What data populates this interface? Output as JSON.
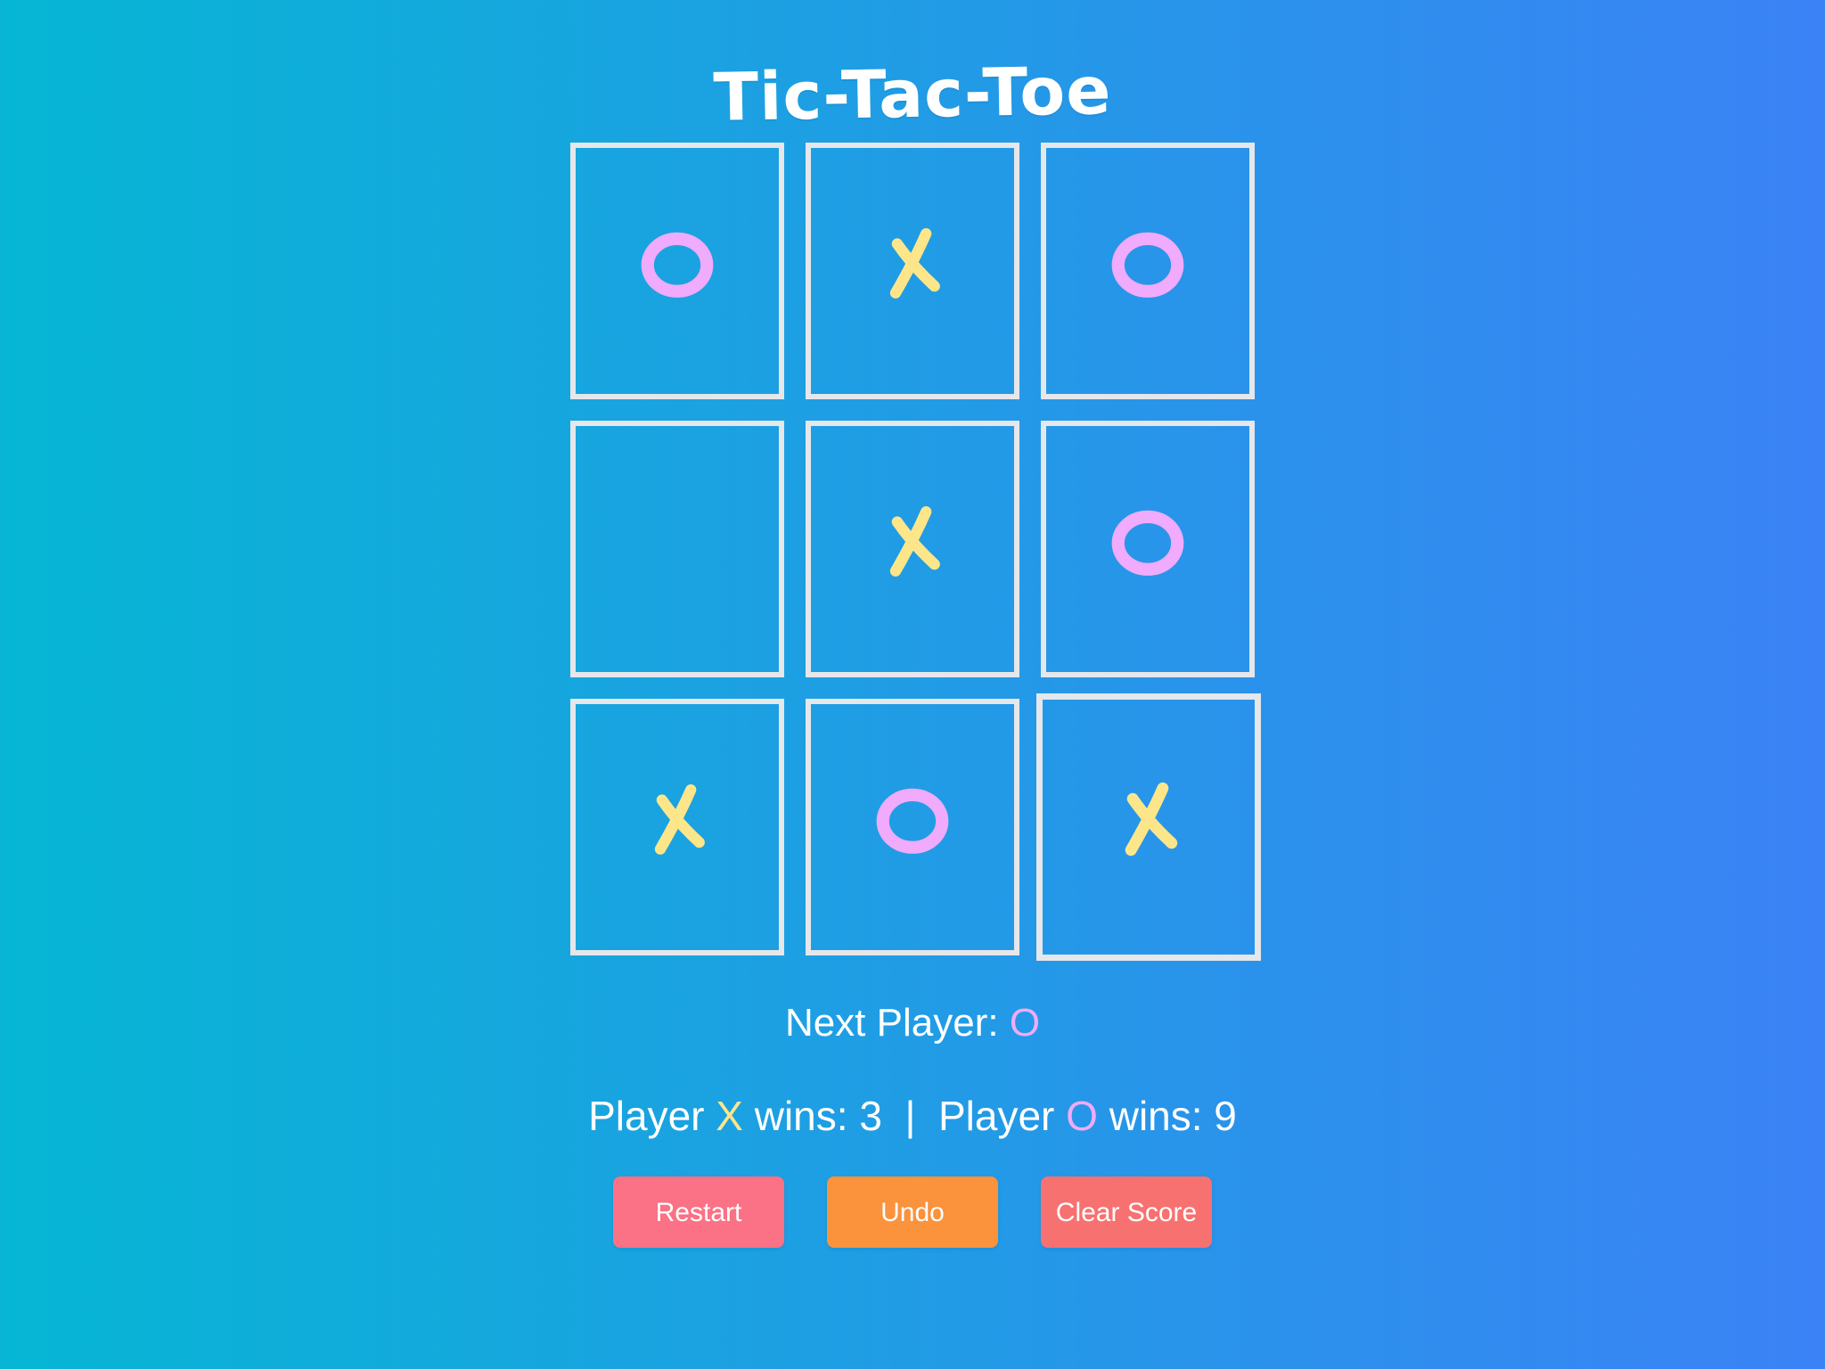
{
  "title": "Tic-Tac-Toe",
  "board": [
    "O",
    "X",
    "O",
    "",
    "X",
    "O",
    "X",
    "O",
    "X"
  ],
  "highlighted_cell": 8,
  "status": {
    "label": "Next Player: ",
    "player": "O"
  },
  "score": {
    "player_word": "Player",
    "x_symbol": "X",
    "x_text": " wins: 3  |  ",
    "o_symbol": "O",
    "o_text": " wins: 9"
  },
  "buttons": {
    "restart": "Restart",
    "undo": "Undo",
    "clear": "Clear Score"
  },
  "colors": {
    "x": "#fde68a",
    "o": "#f0abfc",
    "cell_border": "#e5e7eb",
    "restart": "#fb7185",
    "undo": "#fb923c",
    "clear": "#f87171"
  }
}
